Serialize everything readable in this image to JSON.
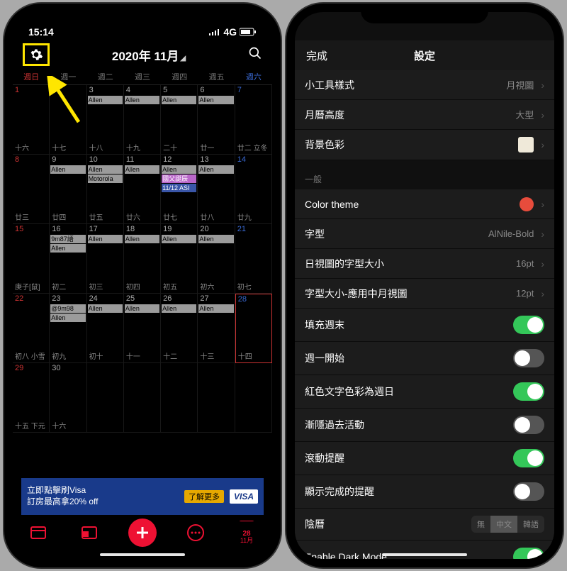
{
  "status": {
    "time": "15:14",
    "net": "4G"
  },
  "header": {
    "title": "2020年 11月"
  },
  "weekdays": [
    "週日",
    "週一",
    "週二",
    "週三",
    "週四",
    "週五",
    "週六"
  ],
  "cells": [
    {
      "dn": "1",
      "sun": true,
      "lun": "十六"
    },
    {
      "dn": "2",
      "lun": "十七"
    },
    {
      "dn": "3",
      "lun": "十八",
      "ev": [
        "Allen"
      ]
    },
    {
      "dn": "4",
      "lun": "十九",
      "ev": [
        "Allen"
      ]
    },
    {
      "dn": "5",
      "lun": "二十",
      "ev": [
        "Allen"
      ]
    },
    {
      "dn": "6",
      "lun": "廿一",
      "ev": [
        "Allen"
      ]
    },
    {
      "dn": "7",
      "sat": true,
      "lun": "廿二 立冬"
    },
    {
      "dn": "8",
      "sun": true,
      "lun": "廿三"
    },
    {
      "dn": "9",
      "lun": "廿四",
      "ev": [
        "Allen"
      ]
    },
    {
      "dn": "10",
      "lun": "廿五",
      "ev": [
        "Allen",
        "Motorola"
      ]
    },
    {
      "dn": "11",
      "lun": "廿六",
      "ev": [
        "Allen"
      ]
    },
    {
      "dn": "12",
      "lun": "廿七",
      "ev": [
        "Allen"
      ],
      "ev2": [
        {
          "t": "國父誕辰",
          "c": "pink"
        },
        {
          "t": "11/12 ASI",
          "c": "blue"
        }
      ]
    },
    {
      "dn": "13",
      "lun": "廿八",
      "ev": [
        "Allen"
      ]
    },
    {
      "dn": "14",
      "sat": true,
      "lun": "廿九"
    },
    {
      "dn": "15",
      "sun": true,
      "lun": "庚子[鼠]"
    },
    {
      "dn": "16",
      "lun": "初二",
      "ev": [
        "9m87語",
        "Allen"
      ]
    },
    {
      "dn": "17",
      "lun": "初三",
      "ev": [
        "Allen"
      ]
    },
    {
      "dn": "18",
      "lun": "初四",
      "ev": [
        "Allen"
      ]
    },
    {
      "dn": "19",
      "lun": "初五",
      "ev": [
        "Allen"
      ]
    },
    {
      "dn": "20",
      "lun": "初六",
      "ev": [
        "Allen"
      ]
    },
    {
      "dn": "21",
      "sat": true,
      "lun": "初七"
    },
    {
      "dn": "22",
      "sun": true,
      "lun": "初八 小雪"
    },
    {
      "dn": "23",
      "lun": "初九",
      "ev": [
        "@9m98",
        "Allen"
      ]
    },
    {
      "dn": "24",
      "lun": "初十",
      "ev": [
        "Allen"
      ]
    },
    {
      "dn": "25",
      "lun": "十一",
      "ev": [
        "Allen"
      ]
    },
    {
      "dn": "26",
      "lun": "十二",
      "ev": [
        "Allen"
      ]
    },
    {
      "dn": "27",
      "lun": "十三",
      "ev": [
        "Allen"
      ]
    },
    {
      "dn": "28",
      "sat": true,
      "lun": "十四",
      "today": true
    },
    {
      "dn": "29",
      "sun": true,
      "lun": "十五 下元"
    },
    {
      "dn": "30",
      "lun": "十六"
    },
    {
      "dn": "",
      "lun": ""
    },
    {
      "dn": "",
      "lun": ""
    },
    {
      "dn": "",
      "lun": ""
    },
    {
      "dn": "",
      "lun": ""
    },
    {
      "dn": "",
      "lun": ""
    }
  ],
  "ad": {
    "line1": "立即點擊刷Visa",
    "line2": "訂房最高拿20% off",
    "btn": "了解更多",
    "brand": "VISA"
  },
  "tabbar": {
    "today": "28",
    "month": "11月"
  },
  "settings": {
    "done": "完成",
    "title": "設定",
    "s1": [
      {
        "label": "小工具樣式",
        "value": "月視圖"
      },
      {
        "label": "月曆高度",
        "value": "大型"
      },
      {
        "label": "背景色彩",
        "swatch": "#efe9d9"
      }
    ],
    "section": "一般",
    "s2": [
      {
        "label": "Color theme",
        "dot": "#e74c3c"
      },
      {
        "label": "字型",
        "value": "AlNile-Bold"
      },
      {
        "label": "日視圖的字型大小",
        "value": "16pt"
      },
      {
        "label": "字型大小-應用中月視圖",
        "value": "12pt"
      },
      {
        "label": "填充週末",
        "toggle": true
      },
      {
        "label": "週一開始",
        "toggle": false
      },
      {
        "label": "紅色文字色彩為週日",
        "toggle": true
      },
      {
        "label": "漸隱過去活動",
        "toggle": false
      },
      {
        "label": "滾動提醒",
        "toggle": true
      },
      {
        "label": "顯示完成的提醒",
        "toggle": false
      },
      {
        "label": "陰曆",
        "seg": [
          "無",
          "中文",
          "韓語"
        ],
        "sel": 1
      },
      {
        "label": "Enable Dark Mode",
        "toggle": true
      }
    ]
  }
}
